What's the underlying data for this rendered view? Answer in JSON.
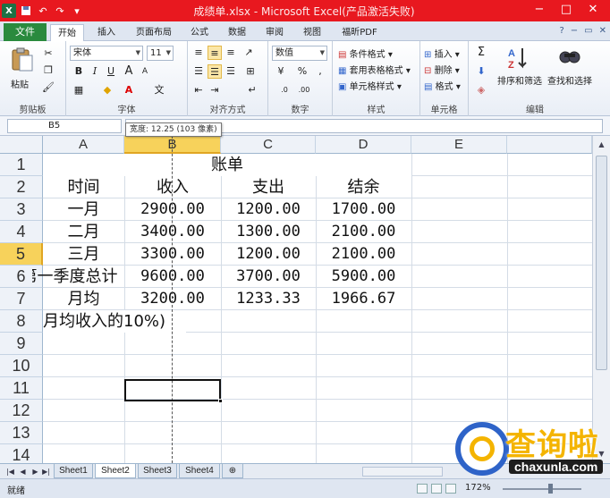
{
  "window": {
    "title": "成绩单.xlsx - Microsoft Excel(产品激活失败)",
    "app_icon": "X",
    "controls": [
      "−",
      "□",
      "✕"
    ]
  },
  "tabs": {
    "file": "文件",
    "items": [
      "开始",
      "插入",
      "页面布局",
      "公式",
      "数据",
      "审阅",
      "视图",
      "福昕PDF"
    ],
    "active": "开始"
  },
  "ribbon": {
    "clipboard": {
      "paste": "粘贴",
      "label": "剪贴板"
    },
    "font": {
      "name": "宋体",
      "size": "11",
      "bold": "B",
      "italic": "I",
      "underline": "U",
      "grow": "A",
      "shrink": "A",
      "label": "字体"
    },
    "alignment": {
      "label": "对齐方式"
    },
    "number": {
      "format": "数值",
      "percent": "%",
      "comma": ",",
      "label": "数字"
    },
    "styles": {
      "conditional": "条件格式",
      "table": "套用表格格式",
      "cell_styles": "单元格样式",
      "label": "样式"
    },
    "cells": {
      "insert": "插入",
      "delete": "删除",
      "format": "格式",
      "label": "单元格"
    },
    "editing": {
      "sigma": "Σ",
      "sort": "排序和筛选",
      "find": "查找和选择",
      "label": "编辑"
    }
  },
  "formula_bar": {
    "name_box": "B5",
    "tooltip": "宽度: 12.25 (103 像素)"
  },
  "sheet": {
    "columns": [
      "A",
      "B",
      "C",
      "D",
      "E"
    ],
    "selected_column": "B",
    "rows": [
      "1",
      "2",
      "3",
      "4",
      "5",
      "6",
      "7",
      "8",
      "9",
      "10",
      "11",
      "12",
      "13",
      "14"
    ],
    "selected_row": "5",
    "title": "账单",
    "headers": [
      "时间",
      "收入",
      "支出",
      "结余"
    ],
    "data": [
      [
        "一月",
        "2900.00",
        "1200.00",
        "1700.00"
      ],
      [
        "二月",
        "3400.00",
        "1300.00",
        "2100.00"
      ],
      [
        "三月",
        "3300.00",
        "1200.00",
        "2100.00"
      ],
      [
        "第一季度总计",
        "9600.00",
        "3700.00",
        "5900.00"
      ],
      [
        "月均",
        "3200.00",
        "1233.33",
        "1966.67"
      ]
    ],
    "note": "月均收入的10%)"
  },
  "sheet_tabs": [
    "Sheet1",
    "Sheet2",
    "Sheet3",
    "Sheet4"
  ],
  "active_sheet": "Sheet2",
  "status": {
    "ready": "就绪",
    "zoom": "172%"
  },
  "watermark": {
    "title": "查询啦",
    "url": "chaxunla.com"
  }
}
